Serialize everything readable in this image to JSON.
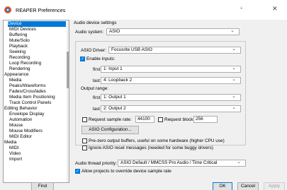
{
  "window": {
    "title": "REAPER Preferences"
  },
  "tree": {
    "items": [
      {
        "label": "Device",
        "selected": true
      },
      {
        "label": "MIDI Devices"
      },
      {
        "label": "Buffering"
      },
      {
        "label": "Mute/Solo"
      },
      {
        "label": "Playback"
      },
      {
        "label": "Seeking"
      },
      {
        "label": "Recording"
      },
      {
        "label": "Loop Recording"
      },
      {
        "label": "Rendering"
      },
      {
        "label": "Appearance",
        "category": true
      },
      {
        "label": "Media"
      },
      {
        "label": "Peaks/Waveforms"
      },
      {
        "label": "Fades/Crossfades"
      },
      {
        "label": "Media Item Positioning"
      },
      {
        "label": "Track Control Panels"
      },
      {
        "label": "Editing Behavior",
        "category": true
      },
      {
        "label": "Envelope Display"
      },
      {
        "label": "Automation"
      },
      {
        "label": "Mouse"
      },
      {
        "label": "Mouse Modifiers"
      },
      {
        "label": "MIDI Editor"
      },
      {
        "label": "Media",
        "category": true
      },
      {
        "label": "MIDI"
      },
      {
        "label": "Video"
      },
      {
        "label": "Import"
      }
    ]
  },
  "device": {
    "section_title": "Audio device settings",
    "audio_system_label": "Audio system:",
    "audio_system_value": "ASIO",
    "asio_driver_label": "ASIO Driver:",
    "asio_driver_value": "Focusrite USB ASIO",
    "enable_inputs_label": "Enable inputs:",
    "enable_inputs_checked": true,
    "input_first_label": "first",
    "input_first_value": "1: Input 1",
    "input_last_label": "last",
    "input_last_value": "4: Loopback 2",
    "output_range_label": "Output range:",
    "output_first_label": "first",
    "output_first_value": "1: Output 1",
    "output_last_label": "last",
    "output_last_value": "2: Output 2",
    "req_rate_label": "Request sample rate:",
    "req_rate_value": "44100",
    "req_block_label": "Request block size:",
    "req_block_value": "256",
    "asio_config_button": "ASIO Configuration...",
    "prezero_label": "Pre-zero output buffers, useful on some hardware (higher CPU use)",
    "ignore_reset_label": "Ignore ASIO reset messages (needed for some buggy drivers)",
    "thread_priority_label": "Audio thread priority:",
    "thread_priority_value": "ASIO Default / MMCSS Pro Audio / Time Critical",
    "allow_override_label": "Allow projects to override device sample rate",
    "allow_override_checked": true
  },
  "footer": {
    "find_button": "Find",
    "ok_button": "OK",
    "cancel_button": "Cancel",
    "apply_button": "Apply"
  },
  "colors": {
    "selection": "#0078d7",
    "icon_orange": "#e05a22",
    "icon_blue": "#2d6bbf"
  }
}
